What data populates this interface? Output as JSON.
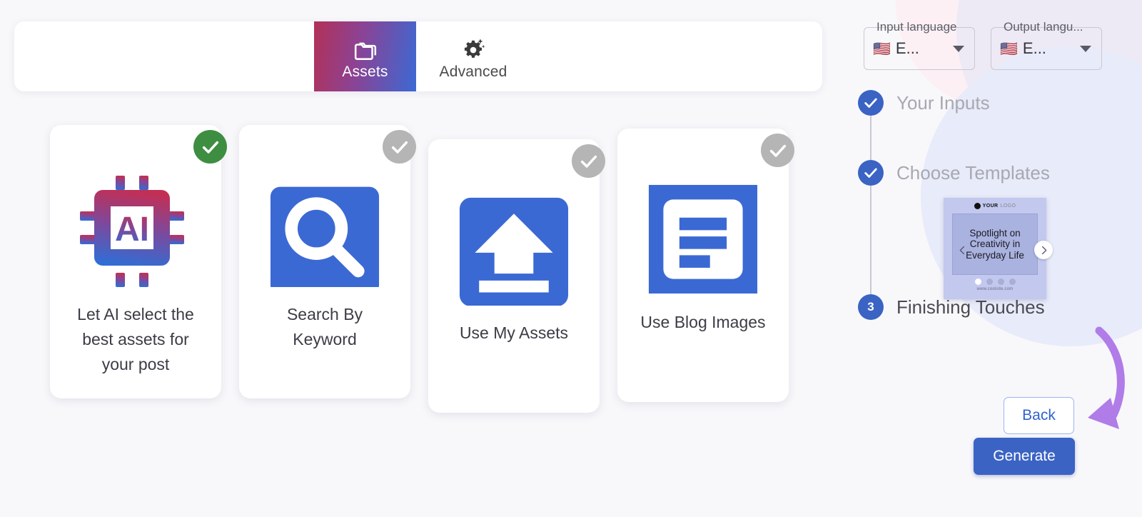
{
  "tabs": [
    {
      "label": "Assets",
      "icon": "folders-icon",
      "active": true
    },
    {
      "label": "Advanced",
      "icon": "gear-sparkle-icon",
      "active": false
    }
  ],
  "asset_cards": [
    {
      "label": "Let AI select the best assets for your post",
      "icon": "ai-chip-icon",
      "selected": true,
      "badge": "check-badge-selected"
    },
    {
      "label": "Search By Keyword",
      "icon": "magnifier-icon",
      "selected": false,
      "badge": "check-badge-unselected"
    },
    {
      "label": "Use My Assets",
      "icon": "upload-icon",
      "selected": false,
      "badge": "check-badge-unselected"
    },
    {
      "label": "Use Blog Images",
      "icon": "blog-lines-icon",
      "selected": false,
      "badge": "check-badge-unselected"
    }
  ],
  "language": {
    "input": {
      "legend": "Input language",
      "value": "E...",
      "flag": "🇺🇸"
    },
    "output": {
      "legend": "Output langu...",
      "value": "E...",
      "flag": "🇺🇸"
    }
  },
  "steps": [
    {
      "label": "Your Inputs",
      "state": "complete",
      "marker": "check"
    },
    {
      "label": "Choose Templates",
      "state": "complete",
      "marker": "check"
    },
    {
      "label": "Finishing Touches",
      "state": "current",
      "marker": "3"
    }
  ],
  "template_preview": {
    "logo_your": "YOUR",
    "logo_logo": "LOGO",
    "headline": "Spotlight on Creativity in Everyday Life",
    "url": "www.coolsite.com",
    "dot_count": 4,
    "active_dot": 1,
    "prev_label": "previous-template",
    "next_label": "next-template"
  },
  "buttons": {
    "back": "Back",
    "generate": "Generate"
  },
  "colors": {
    "accent_blue": "#3b63c4",
    "tab_gradient_start": "#b23157",
    "tab_gradient_end": "#3b69d4",
    "badge_selected": "#3e8e41",
    "badge_unselected": "#b5b5b5",
    "icon_blue": "#3b69d4",
    "annotation_arrow": "#b07ce8",
    "blob_pink": "#fcf0f5",
    "blob_blue": "#e8ebf9"
  }
}
